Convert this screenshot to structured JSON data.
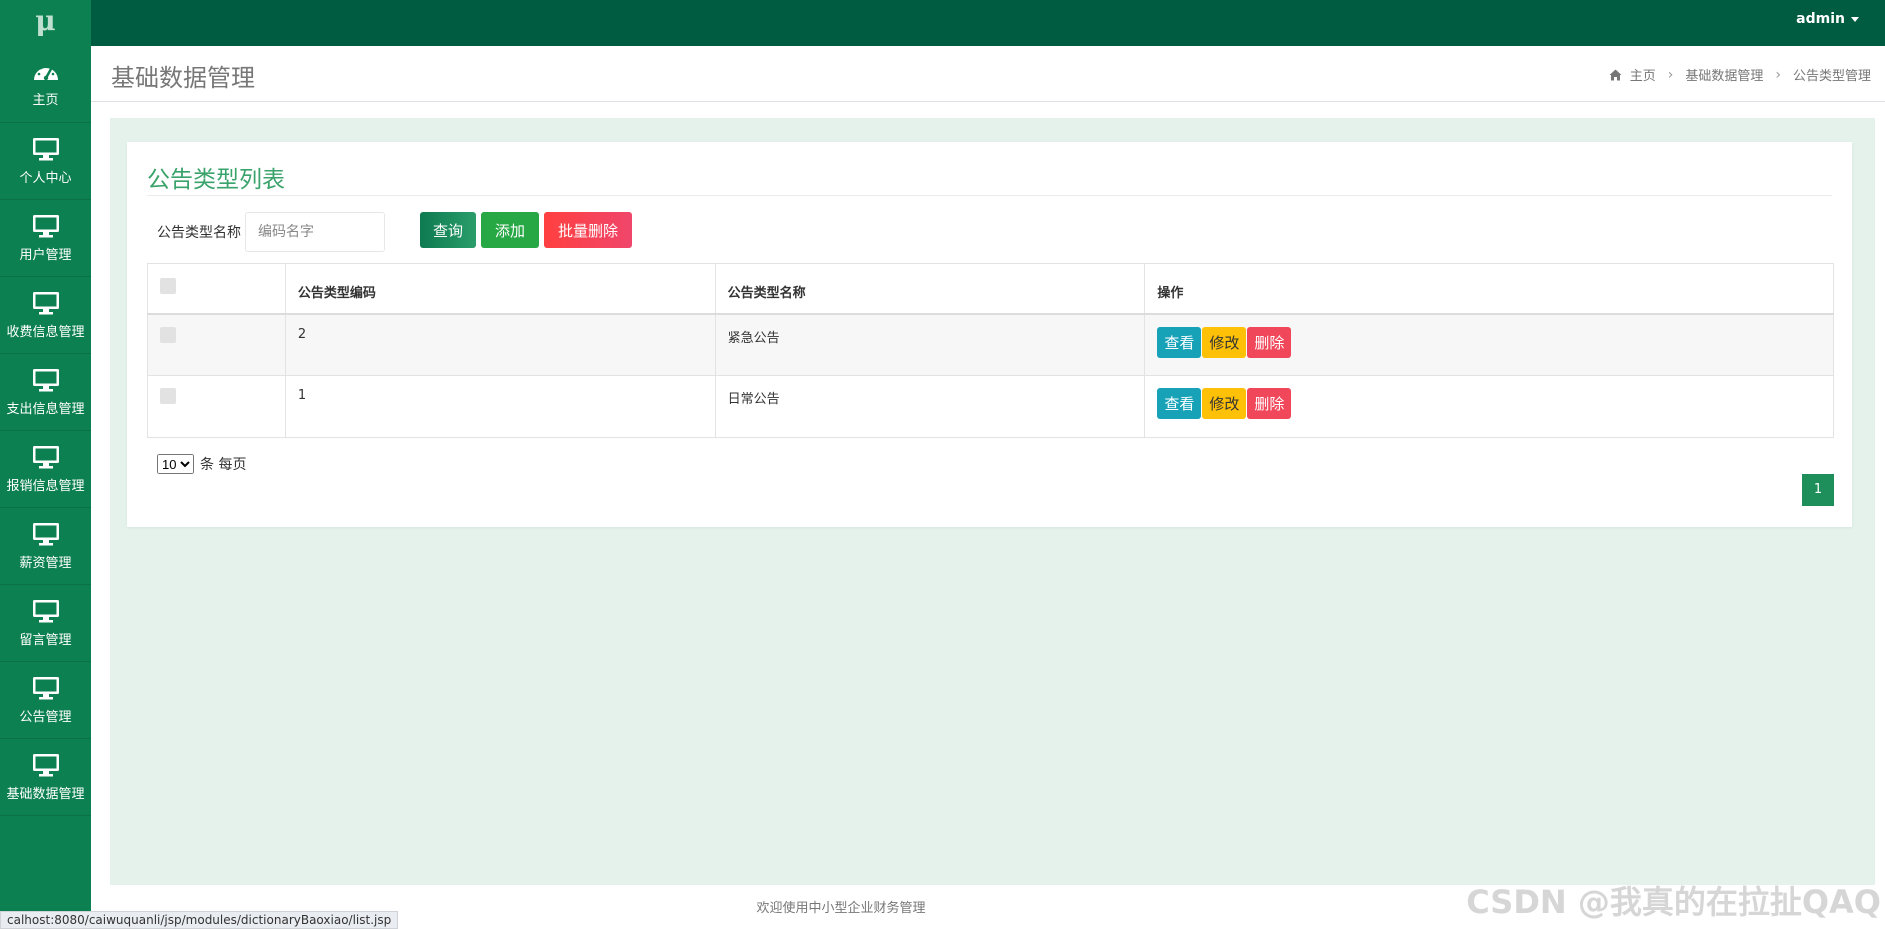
{
  "app": {
    "logo_text": "μ",
    "user": "admin"
  },
  "sidebar": {
    "items": [
      {
        "label": "主页",
        "icon": "dashboard-icon"
      },
      {
        "label": "个人中心",
        "icon": "monitor-icon"
      },
      {
        "label": "用户管理",
        "icon": "monitor-icon"
      },
      {
        "label": "收费信息管理",
        "icon": "monitor-icon"
      },
      {
        "label": "支出信息管理",
        "icon": "monitor-icon"
      },
      {
        "label": "报销信息管理",
        "icon": "monitor-icon"
      },
      {
        "label": "薪资管理",
        "icon": "monitor-icon"
      },
      {
        "label": "留言管理",
        "icon": "monitor-icon"
      },
      {
        "label": "公告管理",
        "icon": "monitor-icon"
      },
      {
        "label": "基础数据管理",
        "icon": "monitor-icon"
      }
    ]
  },
  "header": {
    "title": "基础数据管理",
    "breadcrumb": [
      "主页",
      "基础数据管理",
      "公告类型管理"
    ]
  },
  "card": {
    "title": "公告类型列表",
    "search_label": "公告类型名称",
    "search_placeholder": "编码名字",
    "search_value": "",
    "buttons": {
      "query": "查询",
      "add": "添加",
      "batch_delete": "批量删除"
    }
  },
  "table": {
    "headers": [
      "公告类型编码",
      "公告类型名称",
      "操作"
    ],
    "rows": [
      {
        "code": "2",
        "name": "紧急公告"
      },
      {
        "code": "1",
        "name": "日常公告"
      }
    ],
    "actions": {
      "view": "查看",
      "edit": "修改",
      "delete": "删除"
    }
  },
  "pagination": {
    "page_size": "10",
    "page_size_options": [
      "10"
    ],
    "page_size_suffix": "条 每页",
    "current_page": "1"
  },
  "footer": {
    "text": "欢迎使用中小型企业财务管理"
  },
  "status_bar": {
    "url": "calhost:8080/caiwuquanli/jsp/modules/dictionaryBaoxiao/list.jsp"
  },
  "watermark": "CSDN @我真的在拉扯QAQ",
  "colors": {
    "topbar": "#005c40",
    "sidebar": "#0c8050",
    "content_bg": "#e5f2ec",
    "accent_title": "#3aa36b"
  }
}
